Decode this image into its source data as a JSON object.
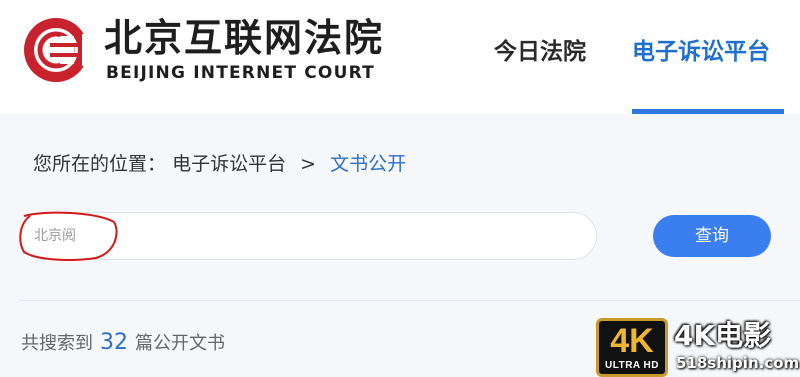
{
  "header": {
    "title": "北京互联网法院",
    "subtitle": "BEIJING INTERNET COURT",
    "nav": [
      {
        "label": "今日法院"
      },
      {
        "label": "电子诉讼平台",
        "active": true
      }
    ],
    "accent_color": "#2f78e0",
    "logo_color": "#c8232c"
  },
  "breadcrumb": {
    "prefix": "您所在的位置：",
    "items": [
      "电子诉讼平台",
      "文书公开"
    ],
    "separator": ">"
  },
  "search": {
    "value": "",
    "placeholder": "北京阅",
    "button_label": "查询"
  },
  "results": {
    "prefix": "共搜索到",
    "count": "32",
    "suffix": "篇公开文书"
  },
  "watermark": {
    "badge_big": "4K",
    "badge_small": "ULTRA HD",
    "title": "4K电影",
    "url": "518shipin.com"
  }
}
